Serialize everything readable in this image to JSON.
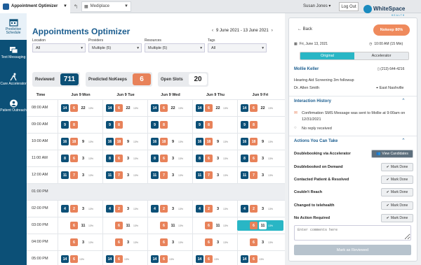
{
  "topbar": {
    "app_name": "Appointment Optimizer",
    "practice": "Mediplace",
    "user": "Susan Jones",
    "logout": "Log Out",
    "brand_name": "WhiteSpace",
    "brand_sub": "HEALTH"
  },
  "sidebar": [
    {
      "label": "Predictive Schedule",
      "icon": "calendar-icon",
      "active": true
    },
    {
      "label": "Text Messaging",
      "icon": "chat-icon",
      "active": false
    },
    {
      "label": "Care Accelerator",
      "icon": "runner-icon",
      "active": false
    },
    {
      "label": "Patient Outreach",
      "icon": "user-icon",
      "active": false
    }
  ],
  "main": {
    "title": "Appointments Optimizer",
    "date_range": "9 June 2021 - 13 June 2021",
    "prev": "‹",
    "next": "›"
  },
  "filters": [
    {
      "label": "Location",
      "value": "All"
    },
    {
      "label": "Providers",
      "value": "Multiple (5)"
    },
    {
      "label": "Resources",
      "value": "Multiple (5)"
    },
    {
      "label": "Tags",
      "value": "All"
    }
  ],
  "stats": [
    {
      "label": "Reviewed",
      "value": "711"
    },
    {
      "label": "Predicted NoKeeps",
      "value": "6"
    },
    {
      "label": "Open Slots",
      "value": "20"
    }
  ],
  "grid": {
    "time_header": "Time",
    "days": [
      "Jun 9 Mon",
      "Jun 9 Tue",
      "Jun 9 Wed",
      "Jun 9 Thu",
      "Jun 9 Fri"
    ],
    "rows": [
      {
        "time": "08:00 AM",
        "cells": [
          {
            "a": "14",
            "b": "6",
            "c": "22",
            "p": "13%"
          },
          {
            "a": "14",
            "b": "6",
            "c": "22",
            "p": "13%"
          },
          {
            "a": "14",
            "b": "6",
            "c": "22",
            "p": "13%"
          },
          {
            "a": "14",
            "b": "6",
            "c": "22",
            "p": "13%"
          },
          {
            "a": "14",
            "b": "6",
            "c": "22",
            "p": "13%"
          }
        ]
      },
      {
        "time": "09:00 AM",
        "cells": [
          {
            "a": "9",
            "b": "8",
            "c": "",
            "p": ""
          },
          {
            "a": "9",
            "b": "8",
            "c": "",
            "p": ""
          },
          {
            "a": "9",
            "b": "8",
            "c": "",
            "p": ""
          },
          {
            "a": "9",
            "b": "8",
            "c": "",
            "p": ""
          },
          {
            "a": "9",
            "b": "8",
            "c": "",
            "p": ""
          }
        ]
      },
      {
        "time": "10:00 AM",
        "cells": [
          {
            "a": "16",
            "b": "18",
            "c": "9",
            "p": "13%"
          },
          {
            "a": "16",
            "b": "18",
            "c": "9",
            "p": "13%"
          },
          {
            "a": "16",
            "b": "18",
            "c": "9",
            "p": "13%"
          },
          {
            "a": "16",
            "b": "18",
            "c": "9",
            "p": "13%"
          },
          {
            "a": "16",
            "b": "18",
            "c": "9",
            "p": "13%"
          }
        ]
      },
      {
        "time": "11:00 AM",
        "cells": [
          {
            "a": "8",
            "b": "6",
            "c": "3",
            "p": "13%"
          },
          {
            "a": "8",
            "b": "6",
            "c": "3",
            "p": "13%"
          },
          {
            "a": "8",
            "b": "6",
            "c": "3",
            "p": "13%"
          },
          {
            "a": "8",
            "b": "6",
            "c": "3",
            "p": "13%"
          },
          {
            "a": "8",
            "b": "6",
            "c": "3",
            "p": "13%"
          }
        ]
      },
      {
        "time": "12:00 AM",
        "cells": [
          {
            "a": "11",
            "b": "7",
            "c": "3",
            "p": "13%"
          },
          {
            "a": "11",
            "b": "7",
            "c": "3",
            "p": "13%"
          },
          {
            "a": "11",
            "b": "7",
            "c": "3",
            "p": "13%"
          },
          {
            "a": "11",
            "b": "7",
            "c": "3",
            "p": "13%"
          },
          {
            "a": "11",
            "b": "7",
            "c": "3",
            "p": "13%"
          }
        ]
      },
      {
        "time": "01:00 PM",
        "cells": []
      },
      {
        "time": "02:00 PM",
        "cells": [
          {
            "a": "4",
            "b": "2",
            "c": "3",
            "p": "13%"
          },
          {
            "a": "4",
            "b": "2",
            "c": "3",
            "p": "13%"
          },
          {
            "a": "4",
            "b": "2",
            "c": "3",
            "p": "13%"
          },
          {
            "a": "4",
            "b": "2",
            "c": "3",
            "p": "13%"
          },
          {
            "a": "4",
            "b": "2",
            "c": "3",
            "p": "13%"
          }
        ]
      },
      {
        "time": "03:00 PM",
        "cells": [
          {
            "a": "",
            "b": "6",
            "c": "11",
            "p": "13%"
          },
          {
            "a": "",
            "b": "6",
            "c": "11",
            "p": "13%"
          },
          {
            "a": "",
            "b": "6",
            "c": "11",
            "p": "13%"
          },
          {
            "a": "",
            "b": "6",
            "c": "11",
            "p": "13%"
          },
          {
            "a": "",
            "b": "6",
            "c": "11",
            "p": "13%",
            "hl": true
          }
        ]
      },
      {
        "time": "04:00 PM",
        "cells": [
          {
            "a": "",
            "b": "6",
            "c": "3",
            "p": "13%"
          },
          {
            "a": "",
            "b": "6",
            "c": "3",
            "p": "13%"
          },
          {
            "a": "",
            "b": "6",
            "c": "3",
            "p": "13%"
          },
          {
            "a": "",
            "b": "6",
            "c": "3",
            "p": "13%"
          },
          {
            "a": "",
            "b": "6",
            "c": "3",
            "p": "13%"
          }
        ]
      },
      {
        "time": "05:00 PM",
        "cells": [
          {
            "a": "14",
            "b": "6",
            "c": "",
            "p": "13%"
          },
          {
            "a": "14",
            "b": "6",
            "c": "",
            "p": "13%"
          },
          {
            "a": "14",
            "b": "6",
            "c": "",
            "p": "13%"
          },
          {
            "a": "14",
            "b": "6",
            "c": "",
            "p": "13%"
          },
          {
            "a": "14",
            "b": "6",
            "c": "",
            "p": "13%"
          }
        ]
      }
    ]
  },
  "panel": {
    "back": "Back",
    "nokeep": "Nokeep 80%",
    "date": "Fri, June 13, 2021",
    "time": "10:00 AM (15 Min)",
    "tabs": [
      "Original",
      "Accelerator"
    ],
    "patient": "Mollie Keller",
    "phone": "(213) 644-4216",
    "reason": "Hearing Aid Screening 3m followup",
    "doctor": "Dr. Allen Smith",
    "location": "East Nashville",
    "history_title": "Interaction History",
    "history_msg": "Confirmation SMS Message was sent to Mollie at 9:00am on 12/31/2021",
    "history_status": "No reply received",
    "actions_title": "Actions You Can Take",
    "actions": [
      {
        "label": "Doublebooking via Accelerator",
        "btn": "View Candidates"
      },
      {
        "label": "Doublebooked on Demand",
        "btn": "Mark Done"
      },
      {
        "label": "Contacted Patient & Resolved",
        "btn": "Mark Done"
      },
      {
        "label": "Couldn't Reach",
        "btn": "Mark Done"
      },
      {
        "label": "Changed to telehealth",
        "btn": "Mark Done"
      },
      {
        "label": "No Action Required",
        "btn": "Mark Done"
      }
    ],
    "comment_placeholder": "Enter comments here",
    "mark_reviewed": "Mark as Reviewed"
  },
  "colors": {
    "sidebar": "#0c5077",
    "accent": "#1b5d8f",
    "orange": "#e8825a",
    "teal": "#29b6c5"
  }
}
